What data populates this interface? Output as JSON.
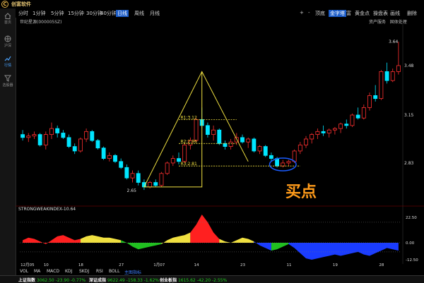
{
  "app": {
    "title": "创富软件",
    "logo_glyph": "C"
  },
  "nav": [
    {
      "label": "首页",
      "icon": "home-icon"
    },
    {
      "label": "沪深",
      "icon": "globe-icon"
    },
    {
      "label": "行情",
      "icon": "chart-icon",
      "active": true
    },
    {
      "label": "选股器",
      "icon": "filter-icon"
    }
  ],
  "toolbar": {
    "periods": [
      "分时",
      "1分钟",
      "5分钟",
      "15分钟",
      "30分钟",
      "60分钟",
      "日线",
      "周线",
      "月线"
    ],
    "active_period": "日线",
    "right": [
      "+",
      "-",
      "顶底",
      "金字塔",
      "富",
      "黄金点",
      "操盘表",
      "画线",
      "删除"
    ],
    "active_right": "金字塔"
  },
  "stock": {
    "name": "世纪星源(000005SZ)"
  },
  "right_links": [
    "资产服务",
    "固体处理"
  ],
  "price_axis": {
    "labels": [
      {
        "value": 3.64,
        "text": "3.64"
      },
      {
        "value": 3.48,
        "text": "3.48"
      },
      {
        "value": 3.15,
        "text": "3.15"
      },
      {
        "value": 2.83,
        "text": "2.83"
      }
    ],
    "low_text": "2.65"
  },
  "pyramid": {
    "r1": "R1:3.12",
    "r2": "R2:2.96",
    "r3": "R3:2.81"
  },
  "buy_label": "买点",
  "indicator": {
    "title": "STRONGWEAKINDEX-10.64",
    "axis": [
      "22.50",
      "0.00",
      "-12.50"
    ]
  },
  "x_axis": [
    "12月05",
    "10",
    "18",
    "27",
    "1月07",
    "14",
    "23",
    "11",
    "19",
    "28"
  ],
  "bottom_tabs": [
    "VOL",
    "MA",
    "MACD",
    "KDJ",
    "SKDJ",
    "RSI",
    "BOLL",
    "主图指标"
  ],
  "status": [
    {
      "name": "上证指数",
      "value": "3062.50",
      "chg": "-23.90",
      "pct": "-0.77%",
      "dir": "down"
    },
    {
      "name": "深证成指",
      "value": "9622.49",
      "chg": "-158.33",
      "pct": "-1.62%",
      "dir": "down"
    },
    {
      "name": "创业板指",
      "value": "1615.62",
      "chg": "-42.20",
      "pct": "-2.55%",
      "dir": "down"
    }
  ],
  "colors": {
    "up": "#ff3030",
    "down": "#00e5ff",
    "pyramid": "#f0e040",
    "buy": "#ff9b1a",
    "circle": "#1a5cff"
  },
  "chart_data": {
    "type": "candlestick",
    "ylim": [
      2.58,
      3.72
    ],
    "candles": [
      [
        3.02,
        3.05,
        2.98,
        3.0
      ],
      [
        3.0,
        3.03,
        2.97,
        3.01
      ],
      [
        3.01,
        3.04,
        2.99,
        3.02
      ],
      [
        3.02,
        3.03,
        2.94,
        2.95
      ],
      [
        2.95,
        3.04,
        2.92,
        3.02
      ],
      [
        3.02,
        3.1,
        2.99,
        3.06
      ],
      [
        3.06,
        3.08,
        3.0,
        3.03
      ],
      [
        3.03,
        3.05,
        2.99,
        3.0
      ],
      [
        3.0,
        3.02,
        2.93,
        2.94
      ],
      [
        2.94,
        2.96,
        2.89,
        2.91
      ],
      [
        2.91,
        3.0,
        2.9,
        2.99
      ],
      [
        2.99,
        3.06,
        2.97,
        3.04
      ],
      [
        3.04,
        3.05,
        2.97,
        2.98
      ],
      [
        2.98,
        2.99,
        2.92,
        2.93
      ],
      [
        2.93,
        2.94,
        2.85,
        2.86
      ],
      [
        2.86,
        2.9,
        2.84,
        2.88
      ],
      [
        2.88,
        2.89,
        2.83,
        2.84
      ],
      [
        2.84,
        2.86,
        2.79,
        2.8
      ],
      [
        2.8,
        2.82,
        2.72,
        2.73
      ],
      [
        2.73,
        2.78,
        2.7,
        2.76
      ],
      [
        2.76,
        2.78,
        2.68,
        2.7
      ],
      [
        2.7,
        2.72,
        2.65,
        2.67
      ],
      [
        2.67,
        2.71,
        2.66,
        2.7
      ],
      [
        2.7,
        2.72,
        2.67,
        2.68
      ],
      [
        2.68,
        2.77,
        2.67,
        2.76
      ],
      [
        2.76,
        2.84,
        2.75,
        2.83
      ],
      [
        2.83,
        2.88,
        2.81,
        2.86
      ],
      [
        2.86,
        2.9,
        2.82,
        2.84
      ],
      [
        2.84,
        2.96,
        2.83,
        2.95
      ],
      [
        2.95,
        3.0,
        2.92,
        2.98
      ],
      [
        2.98,
        3.13,
        2.97,
        3.12
      ],
      [
        3.12,
        3.2,
        3.06,
        3.08
      ],
      [
        3.08,
        3.1,
        3.0,
        3.02
      ],
      [
        3.02,
        3.08,
        2.98,
        3.05
      ],
      [
        3.05,
        3.06,
        2.95,
        2.96
      ],
      [
        2.96,
        2.98,
        2.92,
        2.94
      ],
      [
        2.94,
        2.99,
        2.92,
        2.97
      ],
      [
        2.97,
        3.03,
        2.95,
        3.0
      ],
      [
        3.0,
        3.02,
        2.96,
        2.97
      ],
      [
        2.97,
        3.0,
        2.93,
        2.99
      ],
      [
        2.99,
        3.0,
        2.9,
        2.91
      ],
      [
        2.91,
        2.95,
        2.89,
        2.94
      ],
      [
        2.94,
        2.95,
        2.87,
        2.88
      ],
      [
        2.88,
        2.9,
        2.84,
        2.86
      ],
      [
        2.86,
        2.87,
        2.8,
        2.81
      ],
      [
        2.81,
        2.85,
        2.8,
        2.83
      ],
      [
        2.83,
        2.85,
        2.81,
        2.84
      ],
      [
        2.84,
        2.92,
        2.83,
        2.91
      ],
      [
        2.91,
        2.97,
        2.89,
        2.95
      ],
      [
        2.95,
        3.01,
        2.93,
        2.99
      ],
      [
        2.99,
        3.03,
        2.96,
        3.02
      ],
      [
        3.02,
        3.06,
        2.99,
        3.04
      ],
      [
        3.04,
        3.08,
        3.01,
        3.03
      ],
      [
        3.03,
        3.06,
        3.0,
        3.05
      ],
      [
        3.05,
        3.07,
        3.02,
        3.06
      ],
      [
        3.06,
        3.1,
        3.03,
        3.09
      ],
      [
        3.09,
        3.12,
        3.06,
        3.08
      ],
      [
        3.08,
        3.16,
        3.07,
        3.15
      ],
      [
        3.15,
        3.2,
        3.12,
        3.13
      ],
      [
        3.13,
        3.22,
        3.12,
        3.2
      ],
      [
        3.2,
        3.3,
        3.18,
        3.28
      ],
      [
        3.28,
        3.35,
        3.24,
        3.26
      ],
      [
        3.26,
        3.45,
        3.25,
        3.44
      ],
      [
        3.44,
        3.5,
        3.36,
        3.38
      ],
      [
        3.38,
        3.46,
        3.37,
        3.44
      ],
      [
        3.44,
        3.64,
        3.42,
        3.48
      ]
    ],
    "indicator": [
      2,
      4,
      3,
      1,
      -1,
      2,
      5,
      6,
      4,
      2,
      3,
      5,
      6,
      5,
      4,
      4,
      3,
      2,
      0,
      -3,
      -5,
      -4,
      -3,
      -2,
      -1,
      2,
      4,
      5,
      6,
      8,
      14,
      22,
      16,
      8,
      3,
      1,
      0,
      2,
      4,
      3,
      1,
      -2,
      -4,
      -6,
      -5,
      -3,
      -1,
      -4,
      -8,
      -12,
      -13,
      -12,
      -11,
      -10,
      -9,
      -10,
      -9,
      -8,
      -7,
      -9,
      -10,
      -8,
      -6,
      -4,
      -5,
      -6
    ]
  }
}
